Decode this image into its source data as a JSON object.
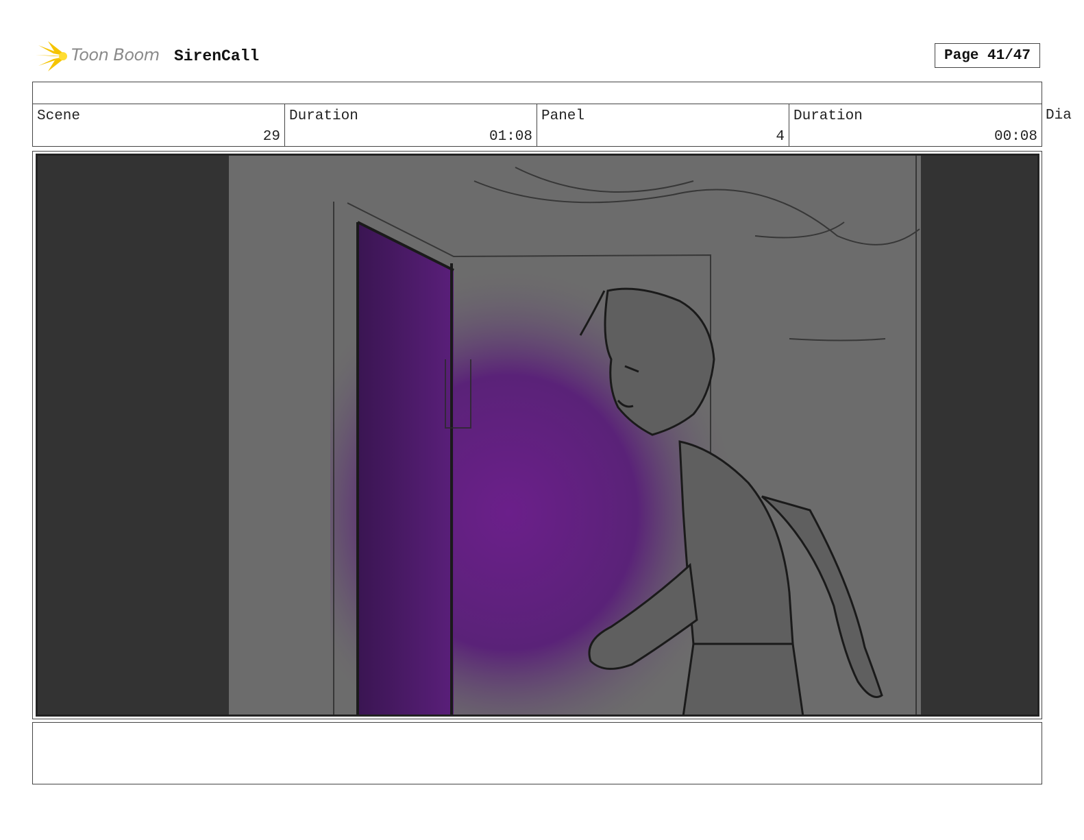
{
  "header": {
    "logo_text": "Toon Boom",
    "project_title": "SirenCall",
    "page_label": "Page 41/47"
  },
  "info": {
    "scene_label": "Scene",
    "scene_value": "29",
    "scene_duration_label": "Duration",
    "scene_duration_value": "01:08",
    "panel_label": "Panel",
    "panel_value": "4",
    "panel_duration_label": "Duration",
    "panel_duration_value": "00:08",
    "dialog_label_partial": "Dia"
  },
  "colors": {
    "letterbox": "#333333",
    "wall": "#6c6c6c",
    "door_glow": "#6b1f8a",
    "door_dark": "#3f1659",
    "logo_yellow": "#f5c400"
  }
}
